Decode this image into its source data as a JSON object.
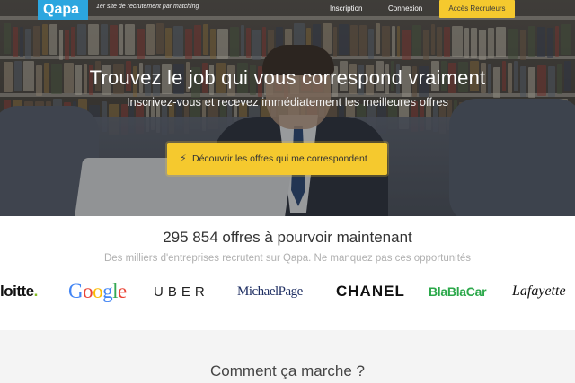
{
  "header": {
    "logo": "Qapa",
    "tagline": "1er site de recrutement par matching",
    "nav": {
      "inscription": "Inscription",
      "connexion": "Connexion"
    },
    "recruiter_button": "Accès Recruteurs"
  },
  "hero": {
    "title": "Trouvez le job qui vous correspond vraiment",
    "subtitle": "Inscrivez-vous et recevez immédiatement les meilleures offres",
    "cta_label": "Découvrir les offres qui me correspondent",
    "cta_icon": "bolt-icon"
  },
  "offers": {
    "title": "295 854 offres à pourvoir maintenant",
    "subtitle": "Des milliers d'entreprises recrutent sur Qapa. Ne manquez pas ces opportunités"
  },
  "brands": {
    "deloitte": "loitte",
    "deloitte_dot": ".",
    "google": "Google",
    "uber": "UBER",
    "michael_page": "MichaelPage",
    "chanel": "CHANEL",
    "blablacar": "BlaBlaCar",
    "lafayette": "Lafayette"
  },
  "how_it_works": {
    "title": "Comment ça marche ?"
  },
  "colors": {
    "accent_yellow": "#f5c92e",
    "brand_blue": "#2ca6df",
    "section_gray": "#f4f4f4"
  }
}
